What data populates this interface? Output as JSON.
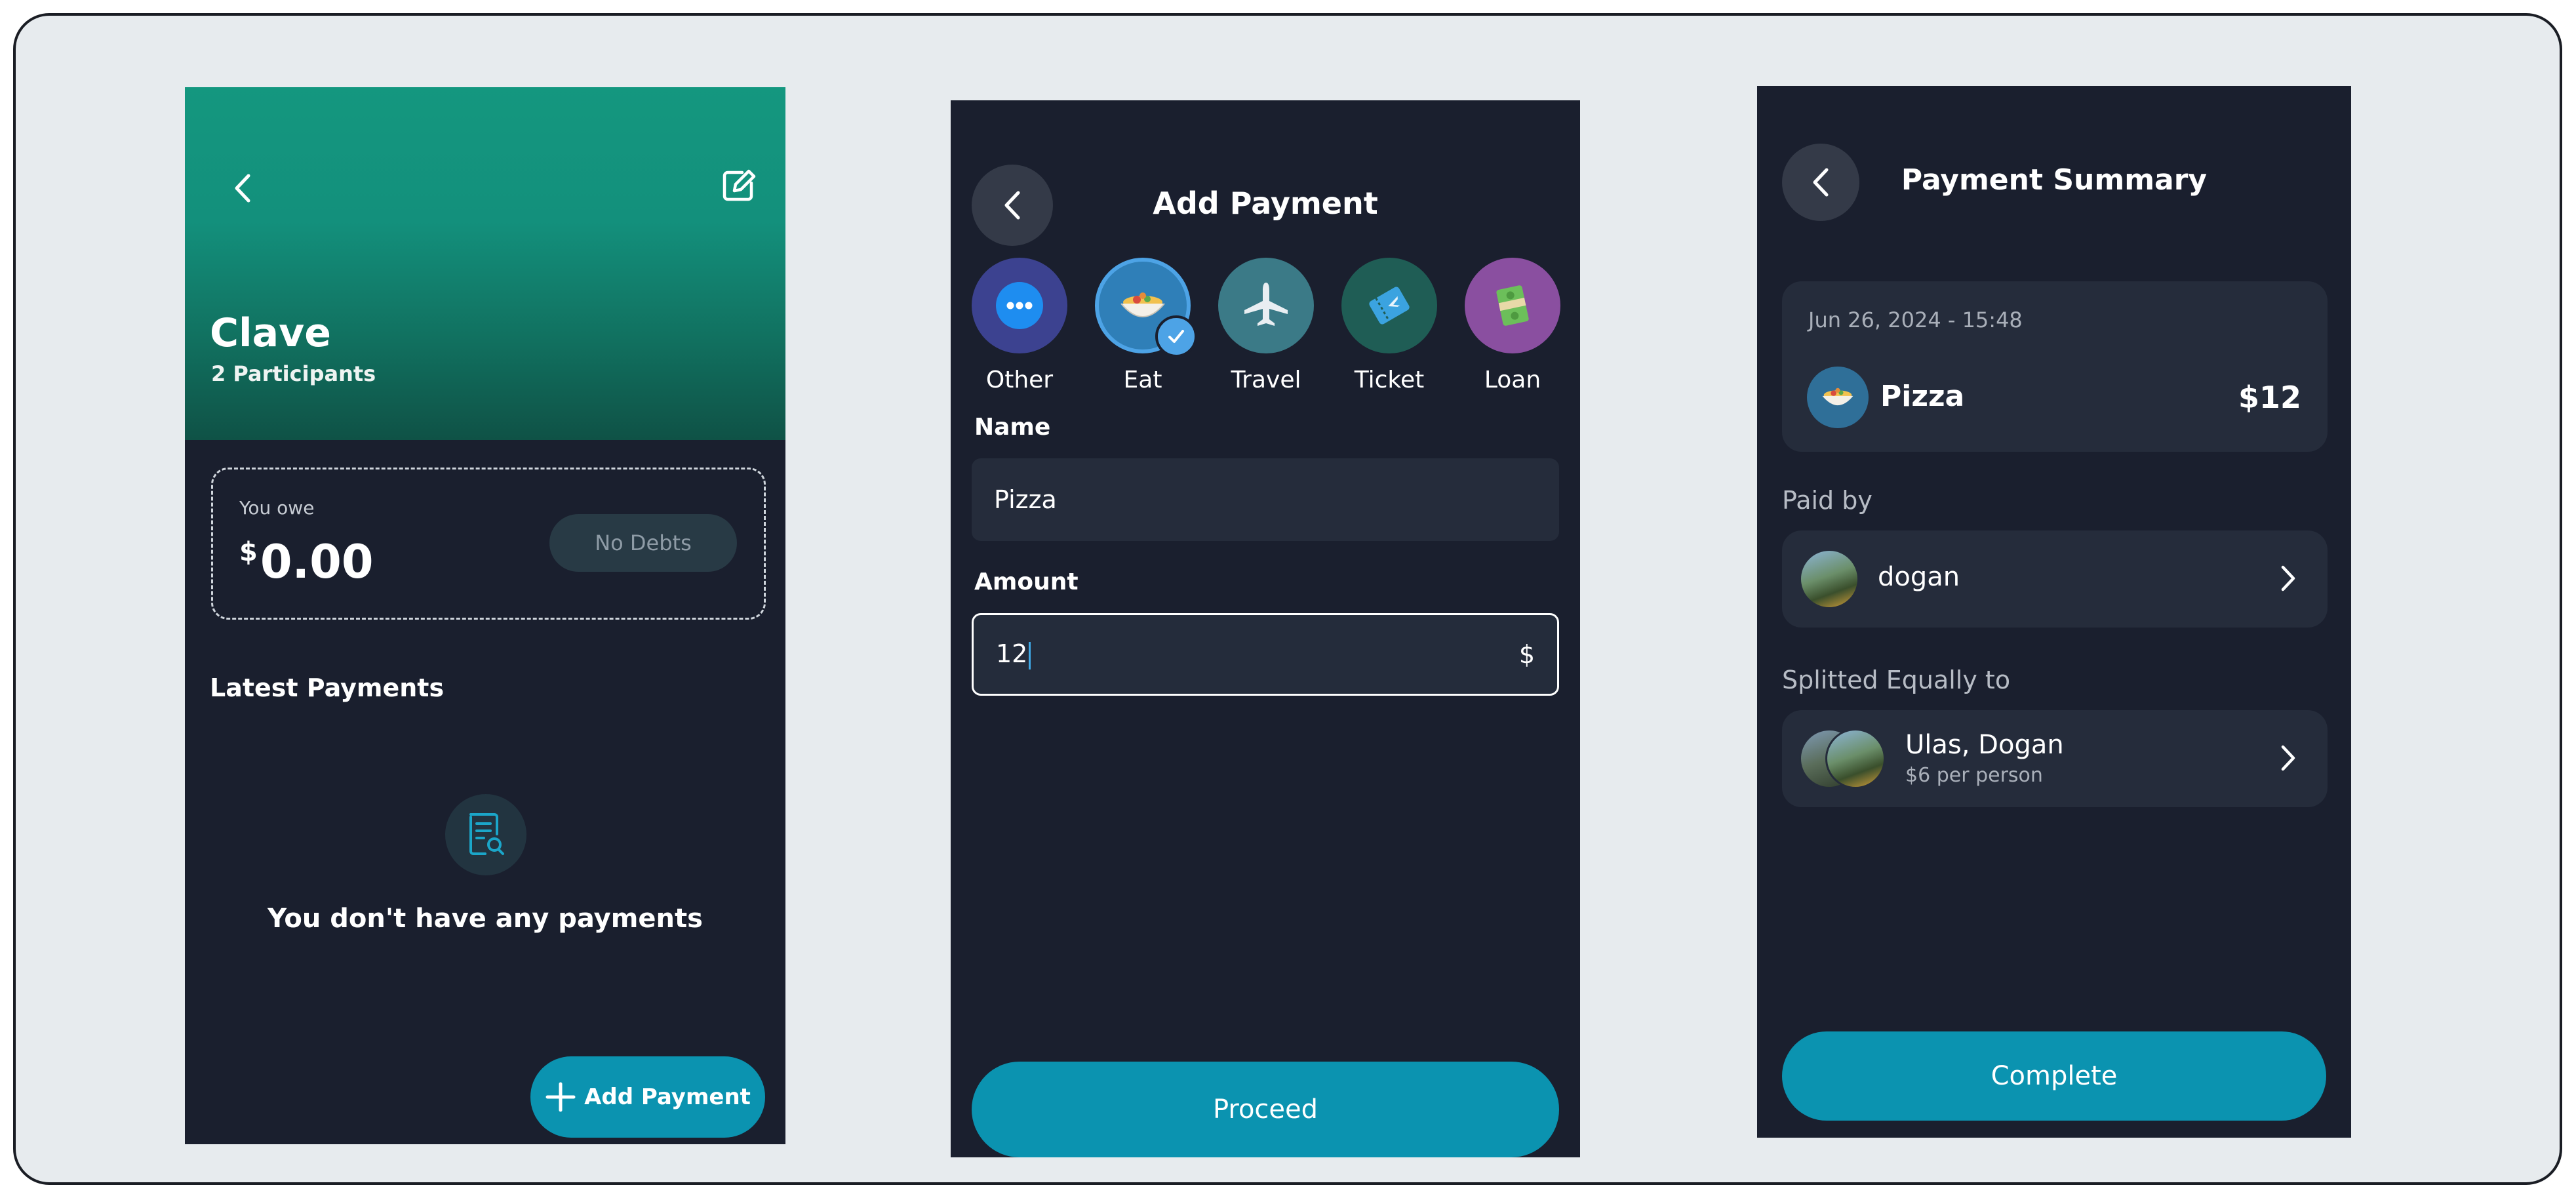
{
  "group_screen": {
    "group_name": "Clave",
    "participants": "2 Participants",
    "you_owe_label": "You owe",
    "currency_symbol": "$",
    "owe_amount": "0.00",
    "no_debts_label": "No Debts",
    "latest_payments_label": "Latest Payments",
    "empty_message": "You don't have any payments",
    "add_payment_label": "Add Payment"
  },
  "add_payment_screen": {
    "title": "Add Payment",
    "categories": [
      {
        "label": "Other",
        "icon": "ellipsis-icon",
        "color": "#3c4290"
      },
      {
        "label": "Eat",
        "icon": "food-bowl-icon",
        "color": "#2f7fb8",
        "selected": true
      },
      {
        "label": "Travel",
        "icon": "airplane-icon",
        "color": "#3b7a87"
      },
      {
        "label": "Ticket",
        "icon": "ticket-icon",
        "color": "#1f5d55"
      },
      {
        "label": "Loan",
        "icon": "money-icon",
        "color": "#8a4fa0"
      }
    ],
    "name_label": "Name",
    "name_value": "Pizza",
    "amount_label": "Amount",
    "amount_value": "12",
    "amount_currency": "$",
    "proceed_label": "Proceed"
  },
  "summary_screen": {
    "title": "Payment Summary",
    "date": "Jun 26, 2024 - 15:48",
    "payment_name": "Pizza",
    "payment_amount": "$12",
    "paid_by_label": "Paid by",
    "payer_name": "dogan",
    "split_label": "Splitted Equally to",
    "split_names": "Ulas, Dogan",
    "split_detail": "$6 per person",
    "complete_label": "Complete"
  },
  "colors": {
    "background": "#e7ebee",
    "phone_bg": "#1a1f2e",
    "accent": "#0b93b0",
    "header_green": "#13907c"
  }
}
